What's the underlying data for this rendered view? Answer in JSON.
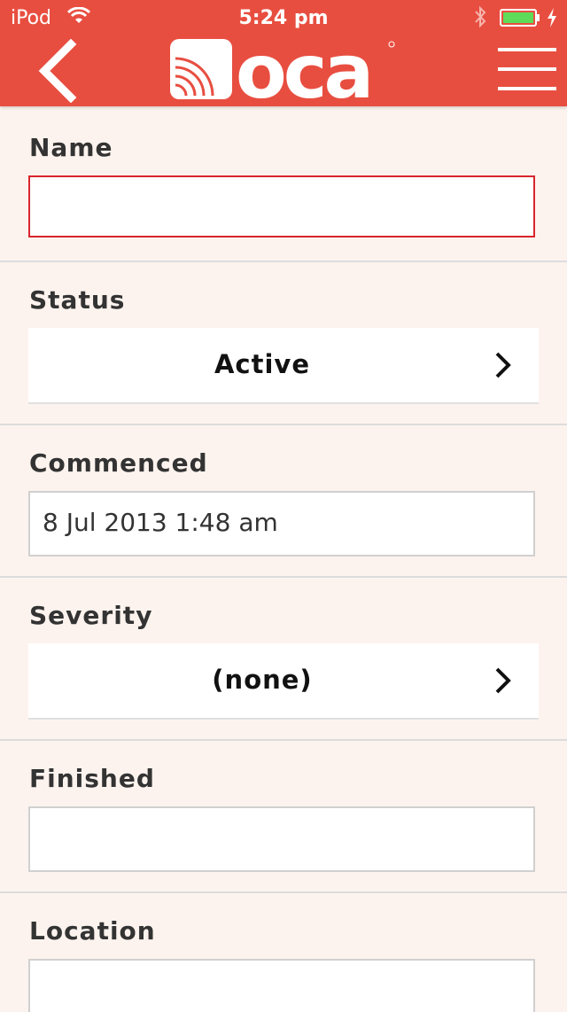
{
  "status_bar": {
    "carrier": "iPod",
    "time": "5:24 pm"
  },
  "nav": {
    "logo_text": "oca",
    "brand_color": "#e84e40"
  },
  "form": {
    "name": {
      "label": "Name",
      "value": ""
    },
    "status": {
      "label": "Status",
      "value": "Active"
    },
    "commenced": {
      "label": "Commenced",
      "value": "8 Jul 2013 1:48 am"
    },
    "severity": {
      "label": "Severity",
      "value": "(none)"
    },
    "finished": {
      "label": "Finished",
      "value": ""
    },
    "location": {
      "label": "Location",
      "value": ""
    }
  }
}
